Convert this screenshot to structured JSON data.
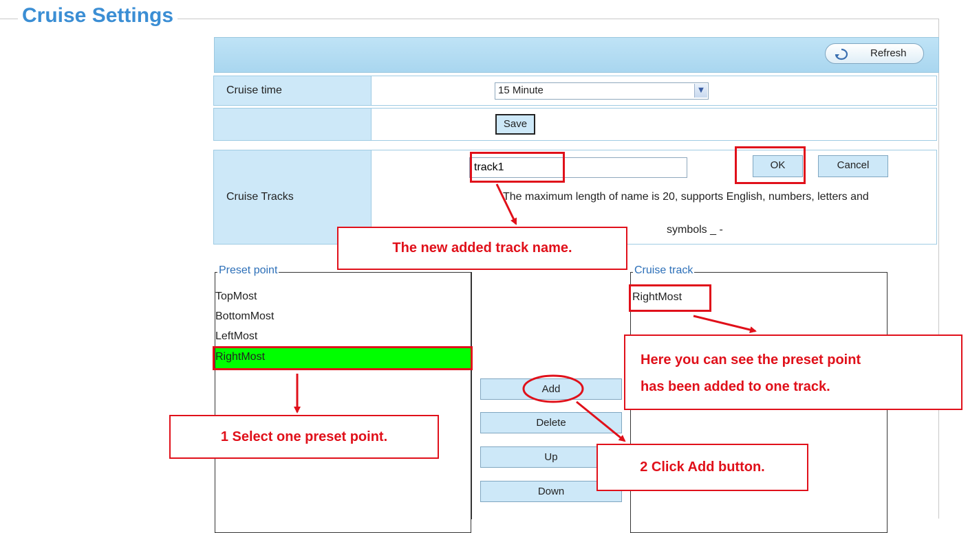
{
  "page_title": "Cruise Settings",
  "toolbar": {
    "refresh_label": "Refresh"
  },
  "cruise_time": {
    "label": "Cruise time",
    "selected": "15 Minute",
    "save_label": "Save"
  },
  "cruise_tracks": {
    "label": "Cruise Tracks",
    "name_value": "track1",
    "ok_label": "OK",
    "cancel_label": "Cancel",
    "note_line1": "The maximum length of name is 20, supports English, numbers, letters and",
    "note_line2": "symbols _ -"
  },
  "preset_point": {
    "legend": "Preset point",
    "items": [
      "TopMost",
      "BottomMost",
      "LeftMost",
      "RightMost"
    ],
    "selected": "RightMost"
  },
  "cruise_track": {
    "legend": "Cruise track",
    "items": [
      "RightMost"
    ]
  },
  "buttons": {
    "add": "Add",
    "delete": "Delete",
    "up": "Up",
    "down": "Down"
  },
  "callouts": {
    "track_name": "The new added track name.",
    "added_line1": "Here you can see the preset point",
    "added_line2": "has been added to one track.",
    "select_preset": "1 Select one preset point.",
    "click_add": "2 Click Add button."
  },
  "colors": {
    "accent": "#3b8ed4",
    "highlight": "#00ff00",
    "annotation": "#e0101a",
    "panel": "#cde8f8"
  }
}
